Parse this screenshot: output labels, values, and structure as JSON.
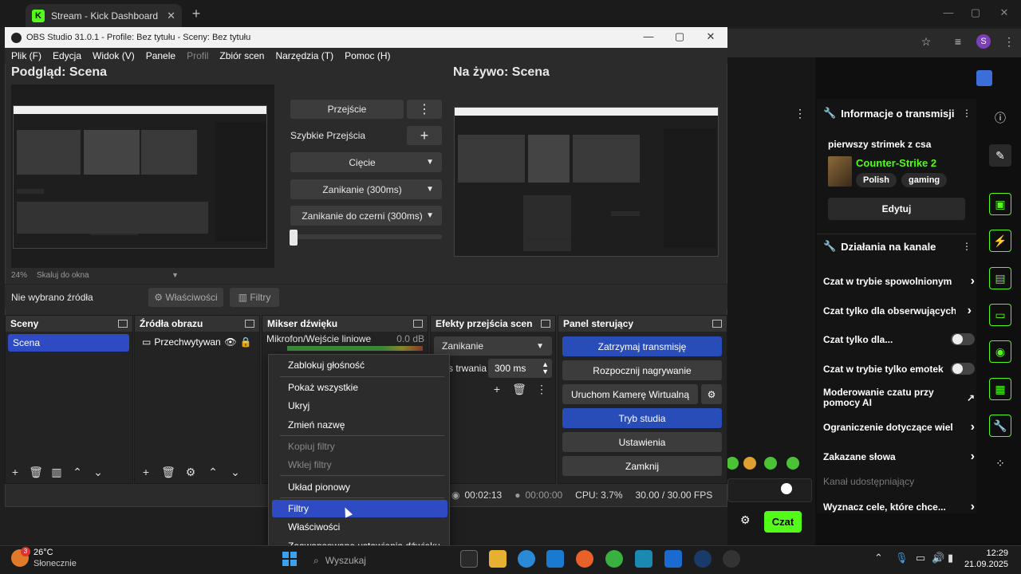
{
  "browser": {
    "tab_title": "Stream - Kick Dashboard",
    "tab_close": "✕",
    "new_tab": "+",
    "profile_initial": "S"
  },
  "obs": {
    "window_title": "OBS Studio 31.0.1 - Profile: Bez tytułu - Sceny: Bez tytułu",
    "menu": [
      "Plik (F)",
      "Edycja",
      "Widok (V)",
      "Panele",
      "Profil",
      "Zbiór scen",
      "Narzędzia (T)",
      "Pomoc (H)"
    ],
    "preview_title": "Podgląd: Scena",
    "live_title": "Na żywo: Scena",
    "zoom_pct": "24%",
    "zoom_mode": "Skaluj do okna",
    "transition_btn": "Przejście",
    "quick_transitions": "Szybkie Przejścia",
    "transitions_list": [
      "Cięcie",
      "Zanikanie (300ms)",
      "Zanikanie do czerni (300ms)"
    ],
    "no_source": "Nie wybrano źródła",
    "properties_btn": "Właściwości",
    "filters_btn": "Filtry",
    "docks": {
      "scenes": "Sceny",
      "sources": "Źródła obrazu",
      "mixer": "Mikser dźwięku",
      "transitions": "Efekty przejścia scen",
      "controls": "Panel sterujący"
    },
    "scene_item": "Scena",
    "source_item": "Przechwytywani",
    "mixer_channel": "Mikrofon/Wejście liniowe",
    "mixer_db": "0.0 dB",
    "transition_select": "Zanikanie",
    "duration_label": "s trwania",
    "duration_value": "300 ms",
    "controls": [
      "Zatrzymaj transmisję",
      "Rozpocznij nagrywanie",
      "Uruchom Kamerę Wirtualną",
      "Tryb studia",
      "Ustawienia",
      "Zamknij"
    ],
    "status": {
      "live_time": "00:02:13",
      "rec_time": "00:00:00",
      "cpu": "CPU: 3.7%",
      "fps": "30.00 / 30.00 FPS"
    }
  },
  "context_menu": {
    "items": [
      "Zablokuj głośność",
      "Pokaż wszystkie",
      "Ukryj",
      "Zmień nazwę",
      "Kopiuj filtry",
      "Wklej filtry",
      "Układ pionowy",
      "Filtry",
      "Właściwości",
      "Zaawansowane ustawienia dźwięku"
    ],
    "highlighted": "Filtry"
  },
  "kick": {
    "stream_info_title": "Informacje o transmisji",
    "stream_title": "pierwszy strimek z csa",
    "game": "Counter-Strike 2",
    "tags": [
      "Polish",
      "gaming"
    ],
    "edit_btn": "Edytuj",
    "channel_actions_title": "Działania na kanale",
    "actions": [
      "Czat w trybie spowolnionym",
      "Czat tylko dla obserwujących",
      "Czat tylko dla...",
      "Czat w trybie tylko emotek",
      "Moderowanie czatu przy pomocy AI",
      "Ograniczenie dotyczące wiel",
      "Zakazane słowa",
      "Kanał udostępniający",
      "Wyznacz cele, które chce..."
    ],
    "chat_btn": "Czat",
    "accent": "#53fc18"
  },
  "taskbar": {
    "temp": "26°C",
    "condition": "Słonecznie",
    "weather_badge": "3",
    "search_placeholder": "Wyszukaj",
    "time": "12:29",
    "date": "21.09.2025"
  }
}
